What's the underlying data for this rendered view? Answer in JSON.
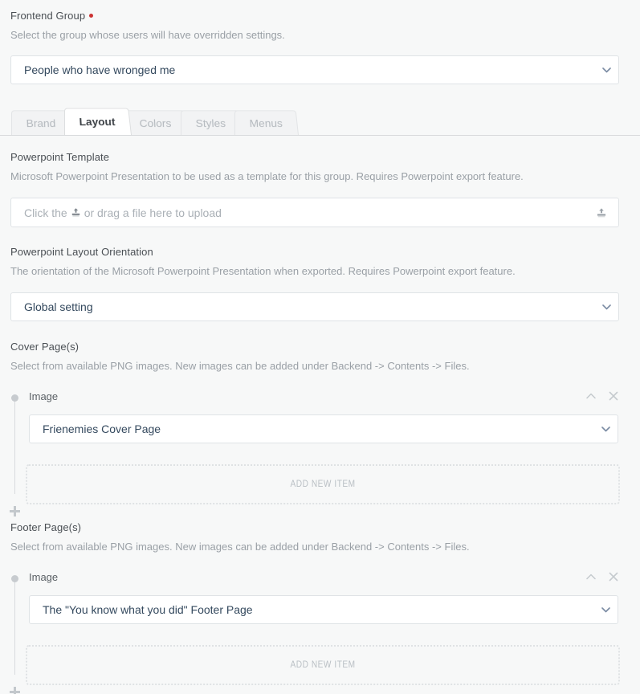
{
  "form": {
    "frontend_group": {
      "label": "Frontend Group",
      "required": true,
      "help": "Select the group whose users will have overridden settings.",
      "value": "People who have wronged me"
    }
  },
  "tabs": [
    {
      "label": "Brand",
      "active": false
    },
    {
      "label": "Layout",
      "active": true
    },
    {
      "label": "Colors",
      "active": false
    },
    {
      "label": "Styles",
      "active": false
    },
    {
      "label": "Menus",
      "active": false
    }
  ],
  "sections": {
    "powerpoint_template": {
      "label": "Powerpoint Template",
      "help": "Microsoft Powerpoint Presentation to be used as a template for this group. Requires Powerpoint export feature.",
      "upload_text_before": "Click the",
      "upload_text_after": "or drag a file here to upload"
    },
    "layout_orientation": {
      "label": "Powerpoint Layout Orientation",
      "help": "The orientation of the Microsoft Powerpoint Presentation when exported. Requires Powerpoint export feature.",
      "value": "Global setting"
    },
    "cover_pages": {
      "label": "Cover Page(s)",
      "help": "Select from available PNG images. New images can be added under Backend -> Contents -> Files.",
      "items": [
        {
          "title": "Image",
          "value": "Frienemies Cover Page"
        }
      ],
      "add_label": "ADD NEW ITEM"
    },
    "footer_pages": {
      "label": "Footer Page(s)",
      "help": "Select from available PNG images. New images can be added under Backend -> Contents -> Files.",
      "items": [
        {
          "title": "Image",
          "value": "The \"You know what you did\" Footer Page"
        }
      ],
      "add_label": "ADD NEW ITEM"
    }
  },
  "icons": {
    "chevron_down": "chevron-down-icon",
    "chevron_up": "chevron-up-icon",
    "close": "close-icon",
    "upload": "upload-icon",
    "plus": "plus-icon",
    "drag_dot": "drag-handle-dot-icon"
  },
  "colors": {
    "page_bg": "#f7f8f8",
    "field_border": "#dfe3e6",
    "value_text": "#34495e",
    "help_text": "#9aa0a6",
    "label_text": "#4a4f54",
    "required_dot": "#cc3333",
    "tab_active_text": "#3c4146",
    "tab_inactive_text": "#b3b8bd",
    "muted_icon": "#c5cace"
  }
}
